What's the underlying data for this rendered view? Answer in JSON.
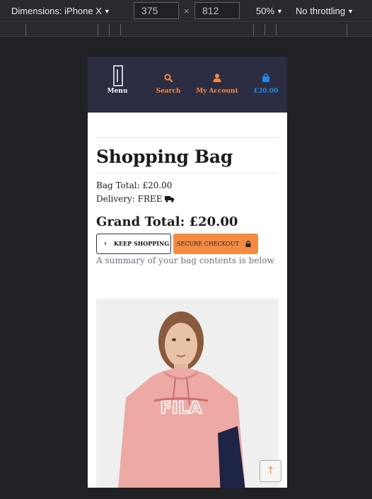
{
  "devtools": {
    "device_label": "Dimensions: iPhone X",
    "width_value": "375",
    "height_value": "812",
    "times": "×",
    "zoom": "50%",
    "throttling": "No throttling"
  },
  "nav": {
    "menu_label": "Menu",
    "search_label": "Search",
    "account_label": "My Account",
    "bag_total": "£20.00"
  },
  "bag": {
    "title": "Shopping Bag",
    "bag_total": "Bag Total: £20.00",
    "delivery": "Delivery: FREE",
    "grand_total": "Grand Total: £20.00",
    "keep_shopping": "KEEP SHOPPING",
    "secure_checkout": "SECURE CHECKOUT",
    "summary": "A summary of your bag contents is below"
  },
  "product": {
    "image_alt": "Pink hoodie product image",
    "print_text": "FILA"
  },
  "colors": {
    "nav_bg": "#2b2d42",
    "accent_orange": "#f58b42",
    "accent_blue": "#1e88e5"
  },
  "icons": [
    "caret-down-icon",
    "search-icon",
    "user-icon",
    "shopping-bag-icon",
    "truck-icon",
    "chevron-left-icon",
    "lock-icon",
    "arrow-up-icon"
  ]
}
